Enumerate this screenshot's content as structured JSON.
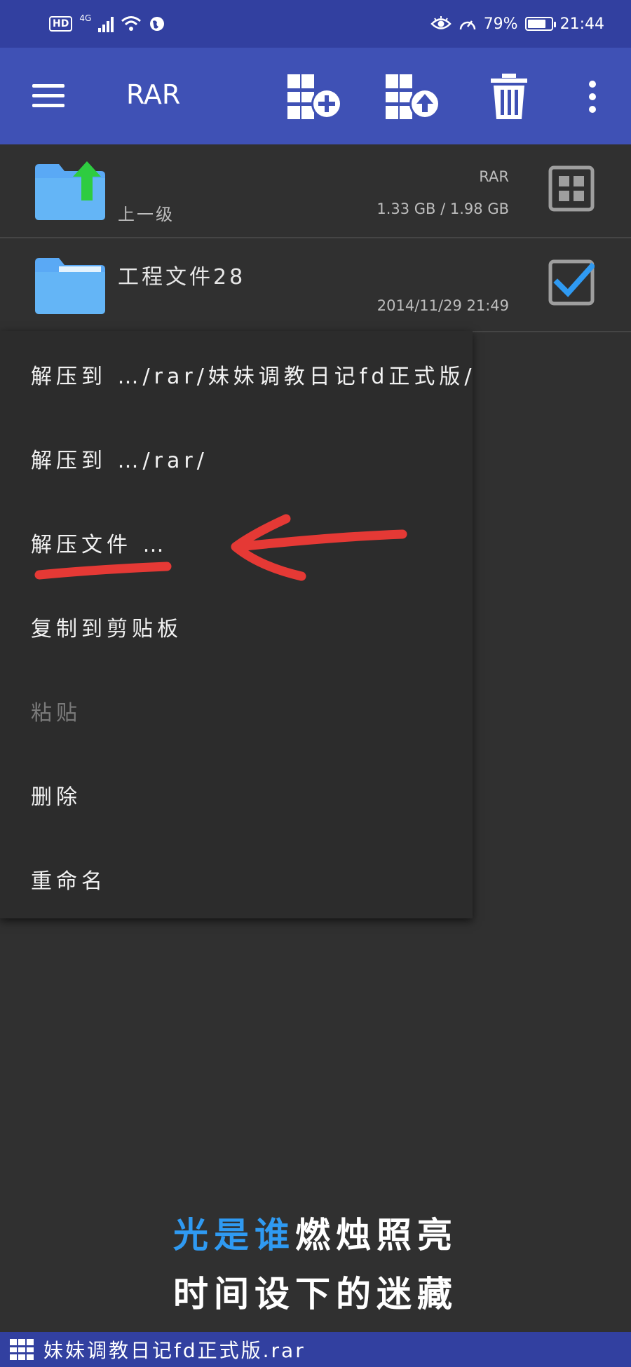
{
  "status_bar": {
    "left_badge": "HD",
    "network": "4G",
    "battery_percent": "79%",
    "battery_level": 0.79,
    "time": "21:44"
  },
  "app_bar": {
    "title": "RAR",
    "icons": [
      "menu-icon",
      "add-to-archive-icon",
      "extract-archive-icon",
      "delete-icon",
      "more-vert-icon"
    ]
  },
  "file_list": [
    {
      "name": "",
      "sub_label": "上一级",
      "right_top": "RAR",
      "right_bottom": "1.33 GB / 1.98 GB",
      "icon": "folder-up-icon",
      "action_icon": "grid-view-icon"
    },
    {
      "name": "工程文件28",
      "sub_label": "",
      "right_top": "",
      "right_bottom": "2014/11/29 21:49",
      "icon": "folder-icon",
      "action_icon": "checkbox-checked-icon"
    }
  ],
  "context_menu": {
    "items": [
      {
        "label": "解压到 …/rar/妹妹调教日记fd正式版/",
        "enabled": true
      },
      {
        "label": "解压到 …/rar/",
        "enabled": true
      },
      {
        "label": "解压文件 …",
        "enabled": true
      },
      {
        "label": "复制到剪贴板",
        "enabled": true
      },
      {
        "label": "粘贴",
        "enabled": false
      },
      {
        "label": "删除",
        "enabled": true
      },
      {
        "label": "重命名",
        "enabled": true
      }
    ]
  },
  "lyrics": {
    "line1_highlight": "光是谁",
    "line1_rest": "燃烛照亮",
    "line2": "时间设下的迷藏"
  },
  "bottom_bar": {
    "filename": "妹妹调教日记fd正式版.rar",
    "icon": "archive-grid-icon"
  },
  "colors": {
    "app_bar": "#3f51b5",
    "status_bar": "#3240a0",
    "background": "#303030",
    "annotation_red": "#e53935",
    "folder_blue": "#64b5f6",
    "check_blue": "#2f9af2"
  }
}
